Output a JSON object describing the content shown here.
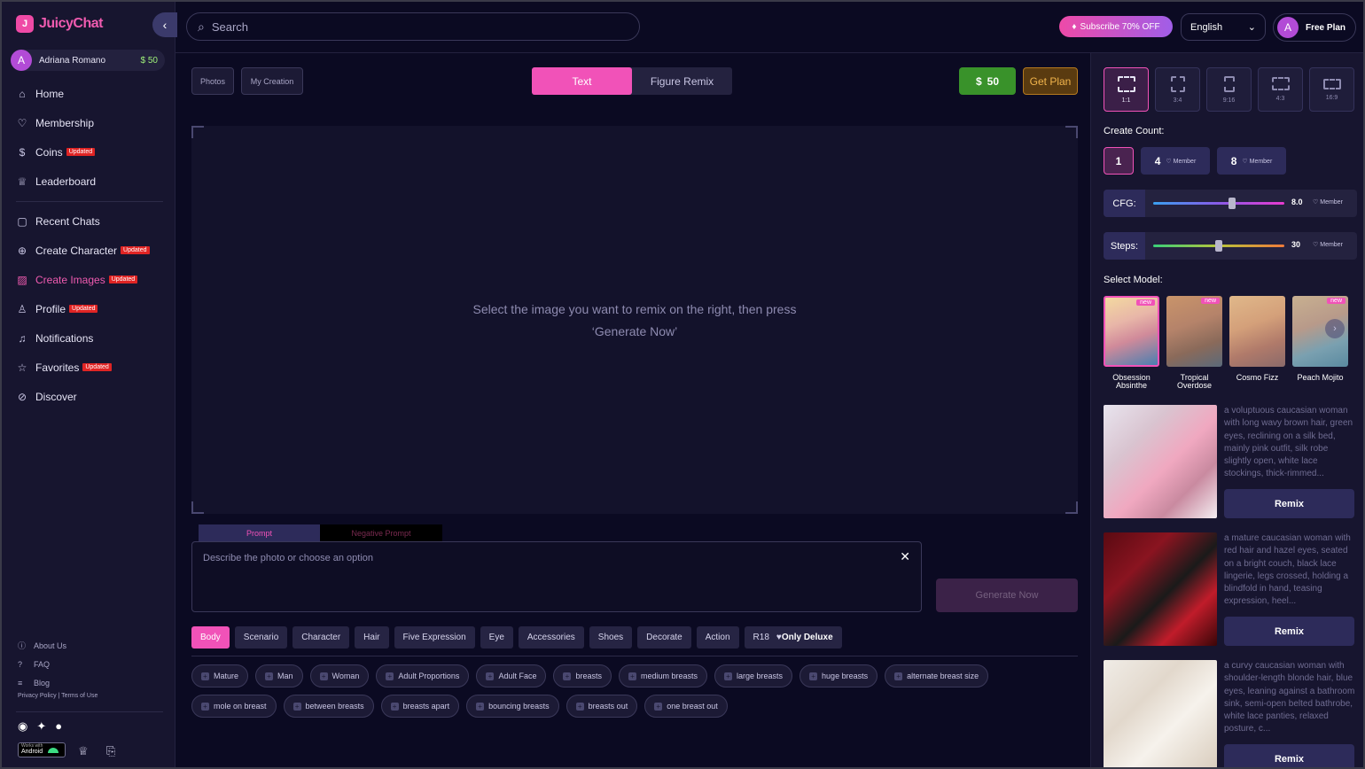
{
  "app": {
    "logo_text": "JuicyChat"
  },
  "user": {
    "initial": "A",
    "name": "Adriana Romano",
    "coins": "50"
  },
  "sidebar": {
    "main_items": [
      {
        "label": "Home",
        "icon": "home-icon",
        "badge": ""
      },
      {
        "label": "Membership",
        "icon": "heart-icon",
        "badge": ""
      },
      {
        "label": "Coins",
        "icon": "coin-icon",
        "badge": "Updated"
      },
      {
        "label": "Leaderboard",
        "icon": "trophy-icon",
        "badge": ""
      }
    ],
    "secondary_items": [
      {
        "label": "Recent Chats",
        "icon": "chat-icon",
        "badge": ""
      },
      {
        "label": "Create Character",
        "icon": "plus-circle-icon",
        "badge": "Updated"
      },
      {
        "label": "Create Images",
        "icon": "image-icon",
        "badge": "Updated"
      },
      {
        "label": "Profile",
        "icon": "user-icon",
        "badge": "Updated"
      },
      {
        "label": "Notifications",
        "icon": "bell-icon",
        "badge": ""
      },
      {
        "label": "Favorites",
        "icon": "star-icon",
        "badge": "Updated"
      },
      {
        "label": "Discover",
        "icon": "compass-icon",
        "badge": ""
      }
    ],
    "footer_links": [
      {
        "label": "About Us",
        "icon": "info-icon"
      },
      {
        "label": "FAQ",
        "icon": "question-icon"
      },
      {
        "label": "Blog",
        "icon": "blog-icon"
      }
    ],
    "legal": "Privacy Policy  |  Terms of Use",
    "android": {
      "line1": "Works with",
      "line2": "Android"
    }
  },
  "topbar": {
    "search_placeholder": "Search",
    "subscribe_label": "Subscribe 70% OFF",
    "language": "English",
    "plan_initial": "A",
    "plan_label": "Free Plan"
  },
  "main": {
    "photos_label": "Photos",
    "my_creation_label": "My Creation",
    "mode_tabs": [
      "Text",
      "Figure Remix"
    ],
    "active_mode": "Text",
    "coins": "50",
    "get_plan_label": "Get Plan",
    "canvas_message_line1": "Select the image you want to remix on the right, then press",
    "canvas_message_line2": "‘Generate Now’",
    "prompt_tab": "Prompt",
    "negative_prompt_tab": "Negative Prompt",
    "prompt_placeholder": "Describe the photo or choose an option",
    "generate_label": "Generate Now",
    "categories": [
      "Body",
      "Scenario",
      "Character",
      "Hair",
      "Five Expression",
      "Eye",
      "Accessories",
      "Shoes",
      "Decorate",
      "Action"
    ],
    "r18_label": "R18",
    "only_deluxe_label": "Only Deluxe",
    "active_category": "Body",
    "tags": [
      "Mature",
      "Man",
      "Woman",
      "Adult Proportions",
      "Adult Face",
      "breasts",
      "medium breasts",
      "large breasts",
      "huge breasts",
      "alternate breast size",
      "mole on breast",
      "between breasts",
      "breasts apart",
      "bouncing breasts",
      "breasts out",
      "one breast out"
    ]
  },
  "right_panel": {
    "ratios": [
      "1:1",
      "3:4",
      "9:16",
      "4:3",
      "16:9"
    ],
    "active_ratio": "1:1",
    "create_count_label": "Create Count:",
    "counts": [
      {
        "value": "1",
        "member": ""
      },
      {
        "value": "4",
        "member": "Member"
      },
      {
        "value": "8",
        "member": "Member"
      }
    ],
    "cfg": {
      "label": "CFG:",
      "value": "8.0",
      "member": "Member",
      "fraction": 0.6
    },
    "steps": {
      "label": "Steps:",
      "value": "30",
      "member": "Member",
      "fraction": 0.5
    },
    "select_model_label": "Select Model:",
    "models": [
      {
        "name": "Obsession Absinthe",
        "is_new": true
      },
      {
        "name": "Tropical Overdose",
        "is_new": true
      },
      {
        "name": "Cosmo Fizz",
        "is_new": false
      },
      {
        "name": "Peach Mojito",
        "is_new": true
      }
    ],
    "new_tag": "new",
    "remix_label": "Remix",
    "remix_cards": [
      {
        "desc": "a voluptuous caucasian woman with long wavy brown hair, green eyes, reclining on a silk bed, mainly pink outfit, silk robe slightly open, white lace stockings, thick-rimmed..."
      },
      {
        "desc": "a mature caucasian woman with red hair and hazel eyes, seated on a bright couch, black lace lingerie, legs crossed, holding a blindfold in hand, teasing expression, heel..."
      },
      {
        "desc": "a curvy caucasian woman with shoulder-length blonde hair, blue eyes, leaning against a bathroom sink, semi-open belted bathrobe, white lace panties, relaxed posture, c..."
      }
    ]
  }
}
